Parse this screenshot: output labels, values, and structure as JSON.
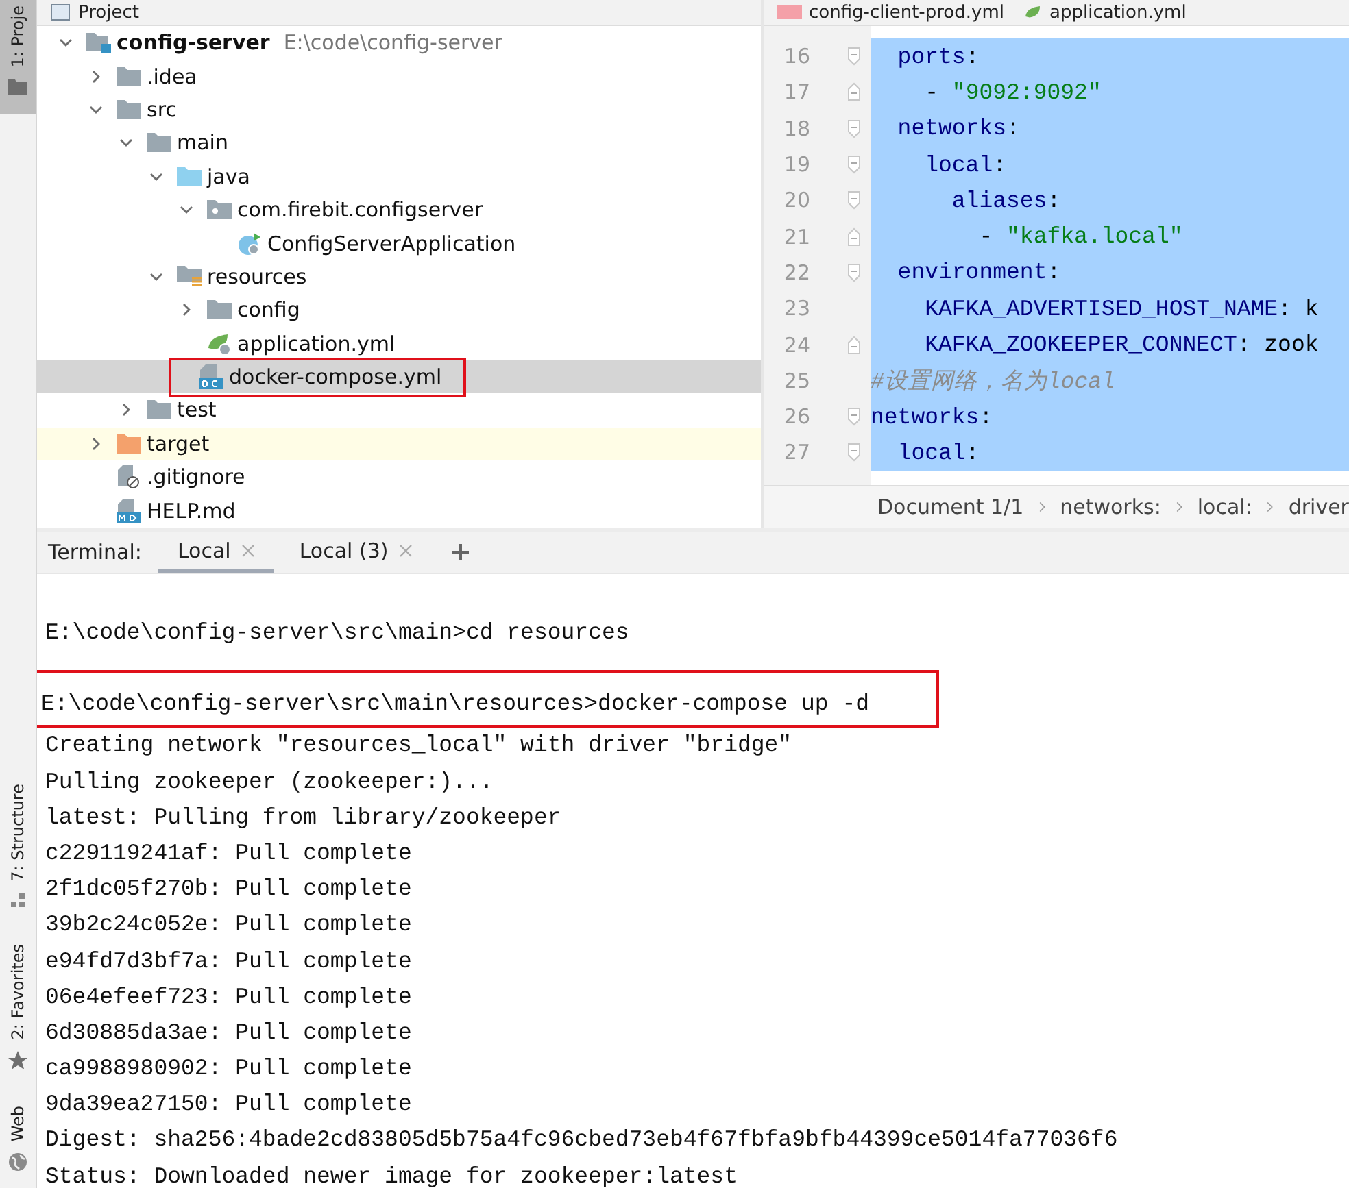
{
  "side_strip": {
    "top": [
      {
        "label": "1: Proje",
        "kind": "project",
        "selected": true
      }
    ],
    "bottom": [
      {
        "label": "7: Structure",
        "kind": "structure",
        "selected": false
      },
      {
        "label": "2: Favorites",
        "kind": "favorites",
        "selected": false
      },
      {
        "label": "Web",
        "kind": "web",
        "selected": false
      }
    ]
  },
  "project_tree": {
    "title": "Project",
    "items": [
      {
        "name": "config-server",
        "path": "E:\\code\\config-server",
        "kind": "module",
        "expanded": true,
        "selected": false,
        "children": [
          {
            "name": ".idea",
            "kind": "folder",
            "expanded": false,
            "selected": false
          },
          {
            "name": "src",
            "kind": "folder",
            "expanded": true,
            "selected": false,
            "children": [
              {
                "name": "main",
                "kind": "folder",
                "expanded": true,
                "selected": false,
                "children": [
                  {
                    "name": "java",
                    "kind": "source-folder",
                    "expanded": true,
                    "selected": false,
                    "children": [
                      {
                        "name": "com.firebit.configserver",
                        "kind": "package",
                        "expanded": true,
                        "selected": false,
                        "children": [
                          {
                            "name": "ConfigServerApplication",
                            "kind": "spring-class",
                            "selected": false
                          }
                        ]
                      }
                    ]
                  },
                  {
                    "name": "resources",
                    "kind": "resources-folder",
                    "expanded": true,
                    "selected": false,
                    "children": [
                      {
                        "name": "config",
                        "kind": "folder",
                        "expanded": false,
                        "selected": false
                      },
                      {
                        "name": "application.yml",
                        "kind": "spring-yml",
                        "selected": false
                      },
                      {
                        "name": "docker-compose.yml",
                        "kind": "docker-compose",
                        "selected": true,
                        "highlighted": true
                      }
                    ]
                  }
                ]
              },
              {
                "name": "test",
                "kind": "folder",
                "expanded": false,
                "selected": false
              }
            ]
          },
          {
            "name": "target",
            "kind": "excluded-folder",
            "expanded": false,
            "selected": false
          },
          {
            "name": ".gitignore",
            "kind": "gitignore",
            "selected": false
          },
          {
            "name": "HELP.md",
            "kind": "markdown",
            "selected": false
          }
        ]
      }
    ]
  },
  "editor": {
    "tabs": [
      {
        "label": "config-client-prod.yml",
        "kind": "yml"
      },
      {
        "label": "application.yml",
        "kind": "spring-yml"
      }
    ],
    "lines": [
      {
        "number": "16",
        "kind": "fold-start",
        "selected": true,
        "tokens": [
          {
            "kind": "key",
            "text": "  ports"
          },
          {
            "kind": "plain",
            "text": ":"
          }
        ]
      },
      {
        "number": "17",
        "kind": "fold-end",
        "selected": true,
        "tokens": [
          {
            "kind": "plain",
            "text": "    - "
          },
          {
            "kind": "string",
            "text": "\"9092:9092\""
          }
        ]
      },
      {
        "number": "18",
        "kind": "fold-start",
        "selected": true,
        "tokens": [
          {
            "kind": "key",
            "text": "  networks"
          },
          {
            "kind": "plain",
            "text": ":"
          }
        ]
      },
      {
        "number": "19",
        "kind": "fold-start",
        "selected": true,
        "tokens": [
          {
            "kind": "key",
            "text": "    local"
          },
          {
            "kind": "plain",
            "text": ":"
          }
        ]
      },
      {
        "number": "20",
        "kind": "fold-start",
        "selected": true,
        "tokens": [
          {
            "kind": "key",
            "text": "      aliases"
          },
          {
            "kind": "plain",
            "text": ":"
          }
        ]
      },
      {
        "number": "21",
        "kind": "fold-end",
        "selected": true,
        "tokens": [
          {
            "kind": "plain",
            "text": "        - "
          },
          {
            "kind": "string",
            "text": "\"kafka.local\""
          }
        ]
      },
      {
        "number": "22",
        "kind": "fold-start",
        "selected": true,
        "tokens": [
          {
            "kind": "key",
            "text": "  environment"
          },
          {
            "kind": "plain",
            "text": ":"
          }
        ]
      },
      {
        "number": "23",
        "kind": "plain",
        "selected": true,
        "tokens": [
          {
            "kind": "key",
            "text": "    KAFKA_ADVERTISED_HOST_NAME"
          },
          {
            "kind": "plain",
            "text": ": k"
          }
        ]
      },
      {
        "number": "24",
        "kind": "fold-end",
        "selected": true,
        "tokens": [
          {
            "kind": "key",
            "text": "    KAFKA_ZOOKEEPER_CONNECT"
          },
          {
            "kind": "plain",
            "text": ": zook"
          }
        ]
      },
      {
        "number": "25",
        "kind": "plain",
        "selected": true,
        "tokens": [
          {
            "kind": "comment",
            "text": "#设置网络，名为local"
          }
        ]
      },
      {
        "number": "26",
        "kind": "fold-start",
        "selected": true,
        "tokens": [
          {
            "kind": "key",
            "text": "networks"
          },
          {
            "kind": "plain",
            "text": ":"
          }
        ]
      },
      {
        "number": "27",
        "kind": "fold-start",
        "selected": true,
        "tokens": [
          {
            "kind": "key",
            "text": "  local"
          },
          {
            "kind": "plain",
            "text": ":"
          }
        ]
      }
    ],
    "breadcrumbs": [
      "Document 1/1",
      "networks:",
      "local:",
      "driver"
    ]
  },
  "terminal": {
    "label": "Terminal:",
    "tabs": [
      {
        "label": "Local",
        "selected": true
      },
      {
        "label": "Local (3)",
        "selected": false
      }
    ],
    "sessions": [
      {
        "prompt": "E:\\code\\config-server\\src\\main>",
        "command": "cd resources",
        "highlighted": false
      },
      {
        "prompt": "E:\\code\\config-server\\src\\main\\resources>",
        "command": "docker-compose up -d",
        "highlighted": true,
        "output": [
          "Creating network \"resources_local\" with driver \"bridge\"",
          "Pulling zookeeper (zookeeper:)...",
          "latest: Pulling from library/zookeeper",
          "c229119241af: Pull complete",
          "2f1dc05f270b: Pull complete",
          "39b2c24c052e: Pull complete",
          "e94fd7d3bf7a: Pull complete",
          "06e4efeef723: Pull complete",
          "6d30885da3ae: Pull complete",
          "ca9988980902: Pull complete",
          "9da39ea27150: Pull complete",
          "Digest: sha256:4bade2cd83805d5b75a4fc96cbed73eb4f67fbfa9bfb44399ce5014fa77036f6",
          "Status: Downloaded newer image for zookeeper:latest"
        ]
      }
    ]
  }
}
